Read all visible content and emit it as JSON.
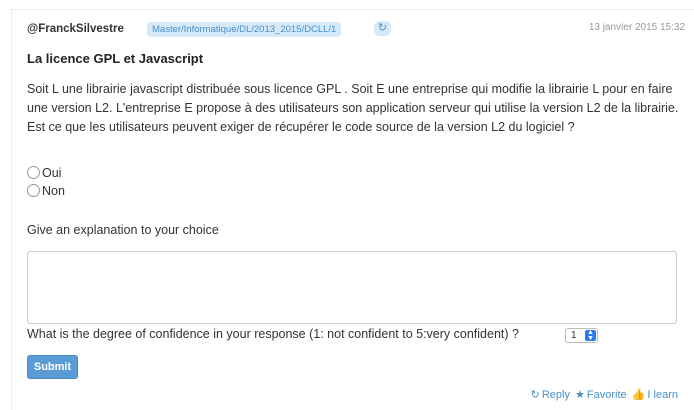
{
  "header": {
    "author": "@FranckSilvestre",
    "path": "Master/Informatique/DL/2013_2015/DCLL/1",
    "refresh_icon": "↻",
    "date": "13 janvier 2015 15:32"
  },
  "question": {
    "title": "La licence GPL et Javascript",
    "text": "Soit L une librairie javascript distribuée sous licence GPL . Soit E une entreprise qui modifie la librairie L pour en faire une version L2. L'entreprise E propose à des utilisateurs son application serveur qui utilise la version L2 de la librairie. Est ce que les utilisateurs peuvent exiger de récupérer le code source de la version L2 du logiciel ?",
    "options": [
      "Oui",
      "Non"
    ]
  },
  "form": {
    "explanation_label": "Give an explanation to your choice",
    "explanation_value": "",
    "confidence_label": "What is the degree of confidence in your response (1: not confident to 5:very confident) ?",
    "confidence_value": "1",
    "submit_label": "Submit"
  },
  "footer": {
    "reply_icon": "↻",
    "reply_label": "Reply",
    "favorite_icon": "★",
    "favorite_label": "Favorite",
    "learn_icon": "👍",
    "learn_label": "I learn"
  },
  "colors": {
    "accent": "#5b9bd5",
    "badge_bg": "#d6e9f8",
    "badge_text": "#4a90c8"
  }
}
